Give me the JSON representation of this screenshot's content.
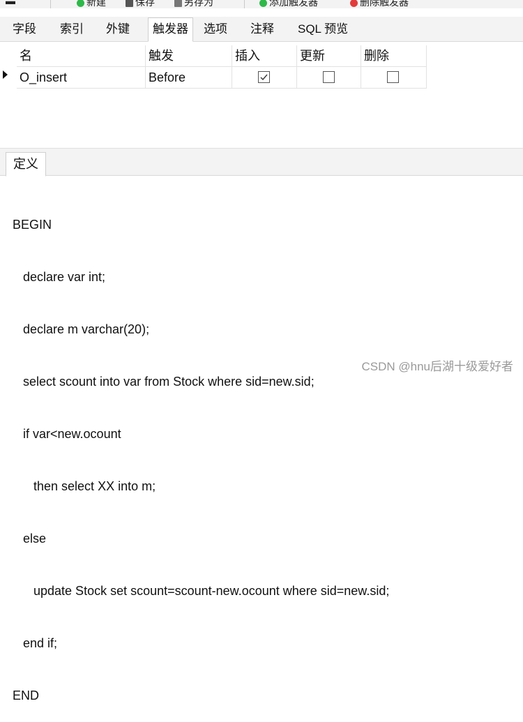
{
  "toolbar": {
    "items": [
      "新建",
      "保存",
      "另存为",
      "添加触发器",
      "删除触发器"
    ],
    "colors": {
      "green": "#2fb84a",
      "red": "#e23b3b"
    }
  },
  "tabs": [
    "字段",
    "索引",
    "外键",
    "触发器",
    "选项",
    "注释",
    "SQL 预览"
  ],
  "active_tab": "触发器",
  "grid": {
    "columns": [
      "名",
      "触发",
      "插入",
      "更新",
      "删除"
    ],
    "rows": [
      {
        "name": "O_insert",
        "trigger": "Before",
        "insert": true,
        "update": false,
        "delete": false
      }
    ]
  },
  "definition": {
    "tab_label": "定义",
    "lines": [
      "BEGIN",
      "   declare var int;",
      "   declare m varchar(20);",
      "   select scount into var from Stock where sid=new.sid;",
      "   if var<new.ocount",
      "      then select XX into m;",
      "   else",
      "      update Stock set scount=scount-new.ocount where sid=new.sid;",
      "   end if;",
      "END"
    ]
  },
  "watermark": "CSDN @hnu后湖十级爱好者"
}
